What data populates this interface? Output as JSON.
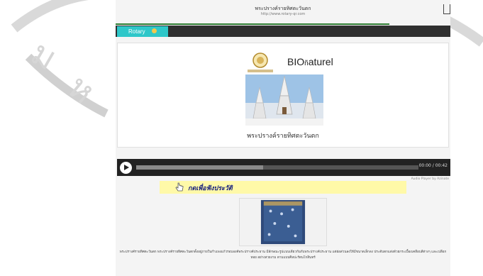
{
  "browser": {
    "title": "พระปรางค์รายทิศตะวันตก",
    "url": "http://www.rotary-qr.com"
  },
  "tabs": {
    "rotary_label": "Rotary"
  },
  "card": {
    "seal_text": "SANWA BIO COMPANY LIMITED",
    "brand_name": "BIOnaturel",
    "caption": "พระปรางค์รายทิศตะวันตก"
  },
  "audio": {
    "time": "00:00 / 00:42",
    "progress": 0.45,
    "powered_by": "Audio Player by Azinate"
  },
  "history_button": {
    "label": "กดเพื่อฟังประวัติ"
  },
  "body_text": "พระปรางค์รายทิศตะวันตก พระปรางค์รายทิศตะวันตกตั้งอยู่ภายในกำแพงแก้วรอบองค์พระปรางค์ประธาน มีลักษณะรูปแบบเดียวกันกับพระปรางค์ประธาน แต่ย่อส่วนลงให้มีขนาดเล็กลง ประดับตกแต่งด้วยกระเบื้องเคลือบสีต่างๆ และเปลือกหอย อย่างสวยงาม ตามแบบศิลปะรัตนโกสินทร์",
  "colors": {
    "tab_accent": "#2ec7c9",
    "history_bg": "#fff9a8",
    "player_bg": "#222222"
  }
}
